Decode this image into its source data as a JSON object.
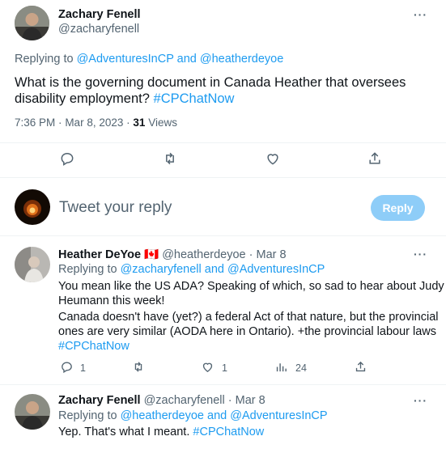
{
  "main_tweet": {
    "author_name": "Zachary Fenell",
    "author_handle": "@zacharyfenell",
    "replying_prefix": "Replying to",
    "replying_handle_1": "@AdventuresInCP",
    "replying_and": "and",
    "replying_handle_2": "@heatherdeyoe",
    "text_line1": "What is the governing document in Canada Heather that oversees",
    "text_line2_prefix": "disability employment?",
    "hashtag": "#CPChatNow",
    "time": "7:36 PM",
    "date": "Mar 8, 2023",
    "views_count": "31",
    "views_label": "Views",
    "more": "···"
  },
  "compose": {
    "placeholder": "Tweet your reply",
    "reply_button": "Reply"
  },
  "reply_1": {
    "author_name": "Heather DeYoe",
    "flag": "🇨🇦",
    "author_handle": "@heatherdeyoe",
    "date": "· Mar 8",
    "replying_prefix": "Replying to",
    "replying_handle_1": "@zacharyfenell",
    "replying_and": "and",
    "replying_handle_2": "@AdventuresInCP",
    "line1": "You mean like the US ADA? Speaking of which, so sad to hear about Judy",
    "line2": "Heumann this week!",
    "line3": "Canada doesn't have (yet?) a federal Act of that nature, but the provincial",
    "line4": "ones are very similar (AODA here in Ontario). +the provincial labour laws",
    "hashtag": "#CPChatNow",
    "reply_count": "1",
    "like_count": "1",
    "views_count": "24",
    "more": "···"
  },
  "reply_2": {
    "author_name": "Zachary Fenell",
    "author_handle": "@zacharyfenell",
    "date": "· Mar 8",
    "replying_prefix": "Replying to",
    "replying_handle_1": "@heatherdeyoe",
    "replying_and": "and",
    "replying_handle_2": "@AdventuresInCP",
    "text_prefix": "Yep. That's what I meant.",
    "hashtag": "#CPChatNow",
    "more": "···"
  },
  "colors": {
    "accent": "#1d9bf0",
    "muted": "#536471",
    "reply_disabled": "#8ecdf8"
  }
}
